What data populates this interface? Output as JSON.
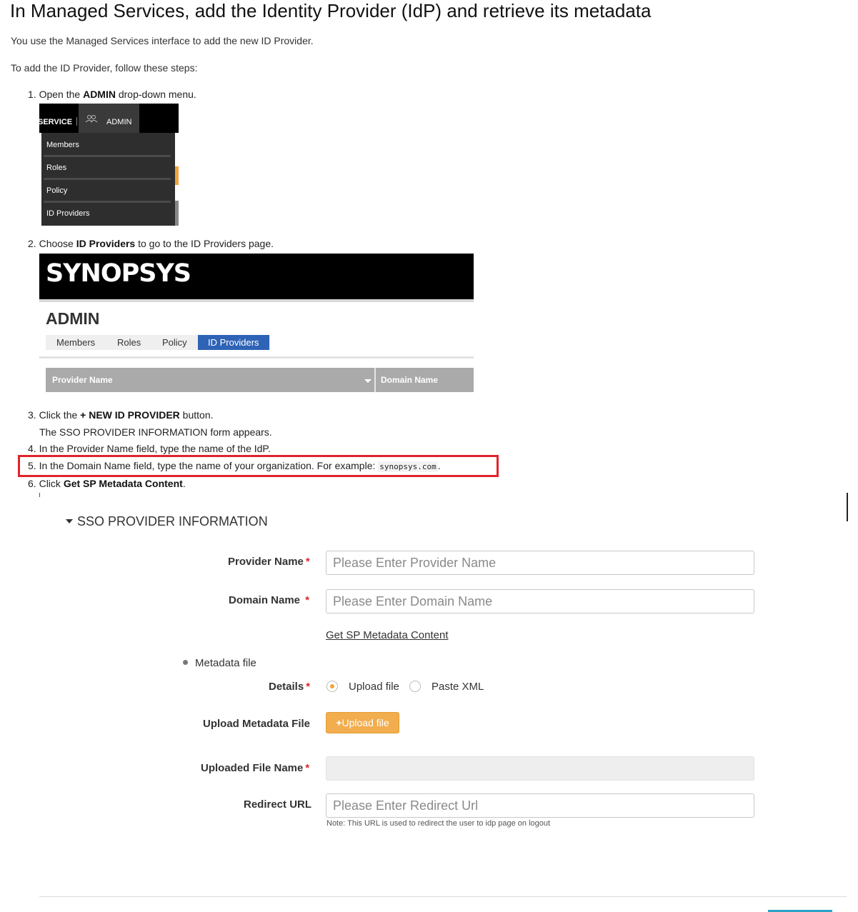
{
  "page": {
    "title": "In Managed Services, add the Identity Provider (IdP) and retrieve its metadata",
    "intro": "You use the Managed Services interface to add the new ID Provider.",
    "lead": "To add the ID Provider, follow these steps:"
  },
  "steps": {
    "s1": {
      "num": "1.",
      "pre": "Open the ",
      "bold": "ADMIN",
      "post": " drop-down menu."
    },
    "s2": {
      "num": "2.",
      "pre": "Choose ",
      "bold": "ID Providers",
      "post": " to go to the ID Providers page."
    },
    "s3": {
      "num": "3.",
      "pre": "Click the ",
      "bold": "+ NEW ID PROVIDER",
      "post": " button."
    },
    "s3_sub": "The SSO PROVIDER INFORMATION form appears.",
    "s4": {
      "num": "4.",
      "text": "In the Provider Name field, type the name of the IdP."
    },
    "s5": {
      "num": "5.",
      "text": "In the Domain Name field, type the name of your organization. For example: ",
      "code": "synopsys.com",
      "post": "."
    },
    "s6": {
      "num": "6.",
      "pre": "Click ",
      "bold": "Get SP Metadata Content",
      "post": "."
    }
  },
  "admin_menu": {
    "service_label": "SERVICE",
    "admin_label": "ADMIN",
    "items": [
      "Members",
      "Roles",
      "Policy",
      "ID Providers"
    ]
  },
  "idp_page": {
    "logo": "SYNOPSYS",
    "heading": "ADMIN",
    "tabs": [
      "Members",
      "Roles",
      "Policy",
      "ID Providers"
    ],
    "active_tab": "ID Providers",
    "columns": [
      "Provider Name",
      "Domain Name"
    ]
  },
  "sso_form": {
    "heading": "SSO PROVIDER INFORMATION",
    "provider_label": "Provider Name",
    "provider_placeholder": "Please Enter Provider Name",
    "domain_label": "Domain Name",
    "domain_placeholder": "Please Enter Domain Name",
    "metadata_link": "Get SP Metadata Content",
    "metadata_option": "Metadata file",
    "details_label": "Details",
    "radio_upload": "Upload file",
    "radio_paste": "Paste XML",
    "upload_label": "Upload Metadata File",
    "upload_button": "Upload file",
    "uploaded_label": "Uploaded File Name",
    "redirect_label": "Redirect URL",
    "redirect_placeholder": "Please Enter Redirect Url",
    "redirect_note": "Note: This URL is used to redirect the user to idp page on logout",
    "required_mark": "*"
  },
  "colors": {
    "highlight": "#e0242c",
    "active_tab": "#2e63b6",
    "upload_button": "#f2ad4e",
    "required": "#e0242c"
  }
}
